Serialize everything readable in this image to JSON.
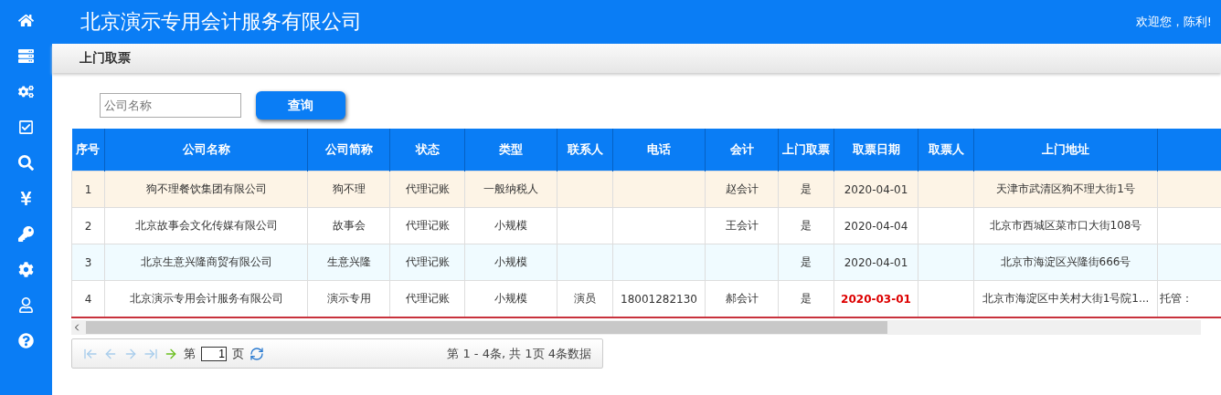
{
  "header": {
    "title": "北京演示专用会计服务有限公司",
    "greeting": "欢迎您，陈利!"
  },
  "breadcrumb": "上门取票",
  "search": {
    "placeholder": "公司名称",
    "button": "查询"
  },
  "table": {
    "columns": [
      "序号",
      "公司名称",
      "公司简称",
      "状态",
      "类型",
      "联系人",
      "电话",
      "会计",
      "上门取票",
      "取票日期",
      "取票人",
      "上门地址",
      ""
    ],
    "rows": [
      {
        "selected": true,
        "overdue": false,
        "cells": [
          "1",
          "狗不理餐饮集团有限公司",
          "狗不理",
          "代理记账",
          "一般纳税人",
          "",
          "",
          "赵会计",
          "是",
          "2020-04-01",
          "",
          "天津市武清区狗不理大街1号",
          ""
        ]
      },
      {
        "selected": false,
        "overdue": false,
        "cells": [
          "2",
          "北京故事会文化传媒有限公司",
          "故事会",
          "代理记账",
          "小规模",
          "",
          "",
          "王会计",
          "是",
          "2020-04-04",
          "",
          "北京市西城区菜市口大街108号",
          ""
        ]
      },
      {
        "selected": false,
        "overdue": false,
        "cells": [
          "3",
          "北京生意兴隆商贸有限公司",
          "生意兴隆",
          "代理记账",
          "小规模",
          "",
          "",
          "",
          "是",
          "2020-04-01",
          "",
          "北京市海淀区兴隆街666号",
          ""
        ]
      },
      {
        "selected": false,
        "overdue": true,
        "cells": [
          "4",
          "北京演示专用会计服务有限公司",
          "演示专用",
          "代理记账",
          "小规模",
          "演员",
          "18001282130",
          "郝会计",
          "是",
          "2020-03-01",
          "",
          "北京市海淀区中关村大街1号院1...",
          "托管："
        ]
      }
    ]
  },
  "pager": {
    "nav_buttons": [
      {
        "kind": "first",
        "disabled": true
      },
      {
        "kind": "prev",
        "disabled": true
      },
      {
        "kind": "next",
        "disabled": true
      },
      {
        "kind": "last",
        "disabled": true
      }
    ],
    "page_prefix": "第",
    "page_value": "1",
    "page_suffix": "页",
    "summary": "第 1 - 4条, 共 1页 4条数据"
  }
}
